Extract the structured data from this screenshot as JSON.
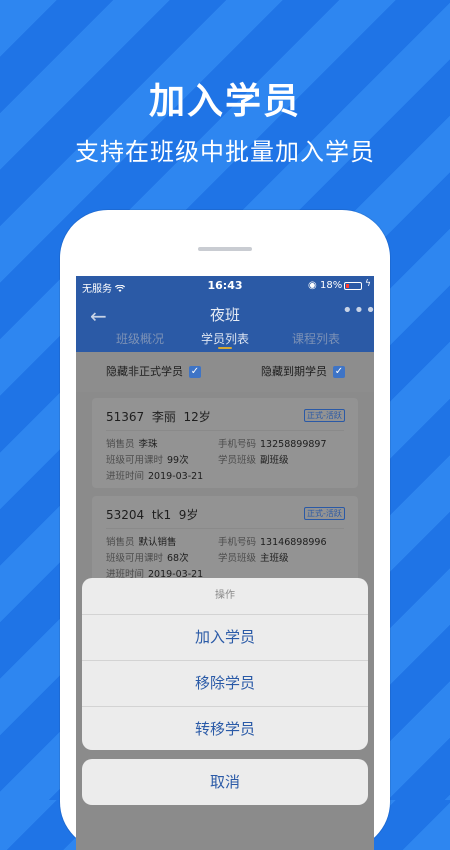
{
  "promo": {
    "headline": "加入学员",
    "subheadline": "支持在班级中批量加入学员"
  },
  "status_bar": {
    "carrier": "无服务",
    "time": "16:43",
    "battery": "18%"
  },
  "nav": {
    "title": "夜班",
    "tabs": [
      {
        "label": "班级概况"
      },
      {
        "label": "学员列表"
      },
      {
        "label": "课程列表"
      }
    ]
  },
  "filters": {
    "hide_informal": "隐藏非正式学员",
    "hide_expired": "隐藏到期学员"
  },
  "students": [
    {
      "id": "51367",
      "name": "李丽",
      "age": "12岁",
      "badge": "正式-活跃",
      "sales_label": "销售员",
      "sales": "李珠",
      "phone_label": "手机号码",
      "phone": "13258899897",
      "hours_label": "班级可用课时",
      "hours": "99次",
      "class_label": "学员班级",
      "class": "副班级",
      "join_label": "进班时间",
      "join": "2019-03-21"
    },
    {
      "id": "53204",
      "name": "tk1",
      "age": "9岁",
      "badge": "正式-活跃",
      "sales_label": "销售员",
      "sales": "默认销售",
      "phone_label": "手机号码",
      "phone": "13146898996",
      "hours_label": "班级可用课时",
      "hours": "68次",
      "class_label": "学员班级",
      "class": "主班级",
      "join_label": "进班时间",
      "join": "2019-03-21"
    }
  ],
  "action_sheet": {
    "title": "操作",
    "actions": [
      {
        "label": "加入学员"
      },
      {
        "label": "移除学员"
      },
      {
        "label": "转移学员"
      }
    ],
    "cancel": "取消"
  },
  "colors": {
    "brand_blue": "#2e86f0",
    "nav_blue": "#2b5aa6",
    "tab_indicator": "#d5a833",
    "action_text": "#2a5aa7"
  }
}
